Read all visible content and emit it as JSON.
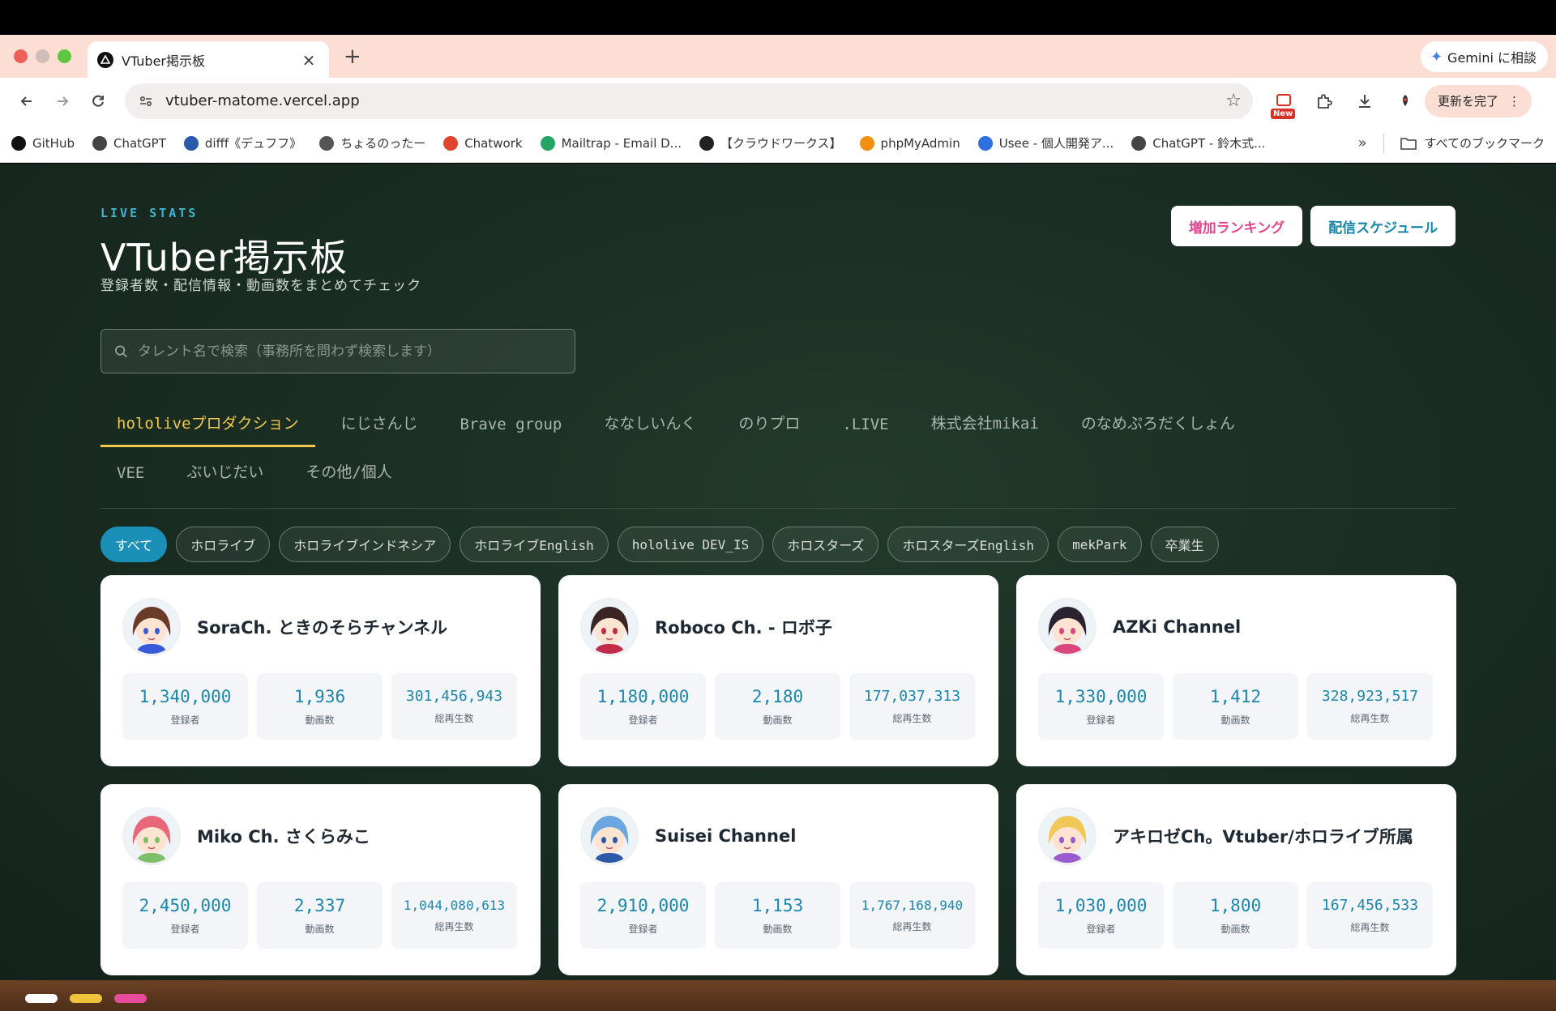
{
  "browser": {
    "tab_title": "VTuber掲示板",
    "url": "vtuber-matome.vercel.app",
    "gemini_label": "Gemini に相談",
    "update_label": "更新を完了",
    "new_badge": "New",
    "bookmarks": [
      {
        "label": "GitHub",
        "icon": "github-icon",
        "color": "#111111"
      },
      {
        "label": "ChatGPT",
        "icon": "chatgpt-icon",
        "color": "#444444"
      },
      {
        "label": "difff《デュフフ》",
        "icon": "difff-icon",
        "color": "#2a5aa8"
      },
      {
        "label": "ちょるのったー",
        "icon": "chorunotter-icon",
        "color": "#555555"
      },
      {
        "label": "Chatwork",
        "icon": "chatwork-icon",
        "color": "#e2452f"
      },
      {
        "label": "Mailtrap - Email D...",
        "icon": "mailtrap-icon",
        "color": "#22a565"
      },
      {
        "label": "【クラウドワークス】",
        "icon": "crowdworks-icon",
        "color": "#222222"
      },
      {
        "label": "phpMyAdmin",
        "icon": "phpmyadmin-icon",
        "color": "#f29111"
      },
      {
        "label": "Usee - 個人開発ア...",
        "icon": "usee-icon",
        "color": "#2f6fe0"
      },
      {
        "label": "ChatGPT - 鈴木式...",
        "icon": "chatgpt-icon",
        "color": "#444444"
      }
    ],
    "all_bookmarks": "すべてのブックマーク"
  },
  "page": {
    "eyebrow": "LIVE STATS",
    "title": "VTuber掲示板",
    "subtitle": "登録者数・配信情報・動画数をまとめてチェック",
    "buttons": {
      "ranking": "増加ランキング",
      "schedule": "配信スケジュール"
    },
    "search_placeholder": "タレント名で検索（事務所を問わず検索します）",
    "agencies_row1": [
      "hololiveプロダクション",
      "にじさんじ",
      "Brave group",
      "ななしいんく",
      "のりプロ",
      ".LIVE",
      "株式会社mikai",
      "のなめぷろだくしょん"
    ],
    "agencies_row2": [
      "VEE",
      "ぶいじだい",
      "その他/個人"
    ],
    "active_agency": "hololiveプロダクション",
    "filters": [
      "すべて",
      "ホロライブ",
      "ホロライブインドネシア",
      "ホロライブEnglish",
      "hololive DEV_IS",
      "ホロスターズ",
      "ホロスターズEnglish",
      "mekPark",
      "卒業生"
    ],
    "active_filter": "すべて",
    "stat_labels": {
      "subscribers": "登録者",
      "videos": "動画数",
      "views": "総再生数"
    },
    "channels": [
      {
        "name": "SoraCh. ときのそらチャンネル",
        "subscribers": "1,340,000",
        "videos": "1,936",
        "views": "301,456,943",
        "hair": "#6b3b2a",
        "accent": "#3a5bd9"
      },
      {
        "name": "Roboco Ch. - ロボ子",
        "subscribers": "1,180,000",
        "videos": "2,180",
        "views": "177,037,313",
        "hair": "#3a2424",
        "accent": "#c22b4a"
      },
      {
        "name": "AZKi Channel",
        "subscribers": "1,330,000",
        "videos": "1,412",
        "views": "328,923,517",
        "hair": "#2b2230",
        "accent": "#d9477d"
      },
      {
        "name": "Miko Ch. さくらみこ",
        "subscribers": "2,450,000",
        "videos": "2,337",
        "views": "1,044,080,613",
        "hair": "#e8677a",
        "accent": "#7fbf6a"
      },
      {
        "name": "Suisei Channel",
        "subscribers": "2,910,000",
        "videos": "1,153",
        "views": "1,767,168,940",
        "hair": "#6aa7e0",
        "accent": "#2d5aa8"
      },
      {
        "name": "アキロゼCh。Vtuber/ホロライブ所属",
        "subscribers": "1,030,000",
        "videos": "1,800",
        "views": "167,456,533",
        "hair": "#f2c75a",
        "accent": "#9a5ad0"
      }
    ]
  }
}
